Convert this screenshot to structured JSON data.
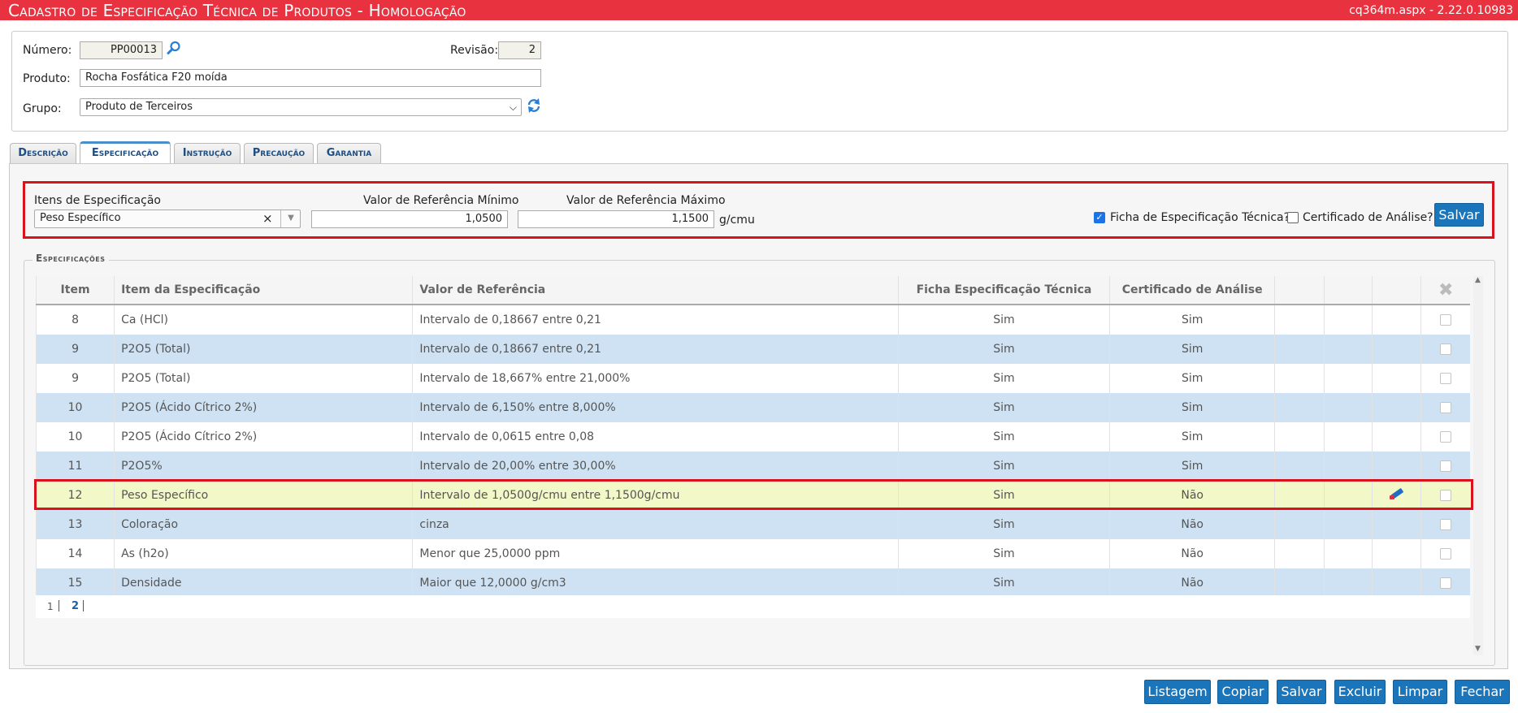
{
  "titlebar": {
    "title": "Cadastro de Especificação Técnica de Produtos  - Homologação",
    "version": "cq364m.aspx - 2.22.0.10983",
    "color": "#e8323f"
  },
  "header": {
    "numero_label": "Número:",
    "numero_value": "PP00013",
    "revisao_label": "Revisão:",
    "revisao_value": "2",
    "produto_label": "Produto:",
    "produto_value": "Rocha Fosfática F20 moída",
    "grupo_label": "Grupo:",
    "grupo_value": "Produto de Terceiros"
  },
  "tabs": [
    {
      "label": "Descrição",
      "active": false
    },
    {
      "label": "Especificação",
      "active": true
    },
    {
      "label": "Instrução",
      "active": false
    },
    {
      "label": "Precaução",
      "active": false
    },
    {
      "label": "Garantia",
      "active": false
    }
  ],
  "filter": {
    "itens_label": "Itens de Especificação",
    "itens_value": "Peso Específico",
    "clear_glyph": "×",
    "min_label": "Valor de Referência Mínimo",
    "min_value": "1,0500",
    "max_label": "Valor de Referência Máximo",
    "max_value": "1,1500",
    "unit": "g/cmu",
    "ficha_label": "Ficha de Especificação Técnica?",
    "ficha_checked": true,
    "cert_label": "Certificado de Análise?",
    "cert_checked": false,
    "save_label": "Salvar"
  },
  "specs": {
    "legend": "Especificações",
    "columns": [
      "Item",
      "Item da Especificação",
      "Valor de Referência",
      "Ficha Especificação Técnica",
      "Certificado de Análise"
    ],
    "rows": [
      {
        "item": "8",
        "name": "Ca (HCl)",
        "ref": "Intervalo de 0,18667 entre 0,21",
        "ficha": "Sim",
        "cert": "Sim"
      },
      {
        "item": "9",
        "name": "P2O5 (Total)",
        "ref": "Intervalo de 0,18667 entre 0,21",
        "ficha": "Sim",
        "cert": "Sim"
      },
      {
        "item": "9",
        "name": "P2O5 (Total)",
        "ref": "Intervalo de 18,667% entre 21,000%",
        "ficha": "Sim",
        "cert": "Sim"
      },
      {
        "item": "10",
        "name": "P2O5 (Ácido Cítrico 2%)",
        "ref": "Intervalo de 6,150% entre 8,000%",
        "ficha": "Sim",
        "cert": "Sim"
      },
      {
        "item": "10",
        "name": "P2O5 (Ácido Cítrico 2%)",
        "ref": "Intervalo de 0,0615 entre 0,08",
        "ficha": "Sim",
        "cert": "Sim"
      },
      {
        "item": "11",
        "name": "P2O5%",
        "ref": "Intervalo de 20,00% entre 30,00%",
        "ficha": "Sim",
        "cert": "Sim"
      },
      {
        "item": "12",
        "name": "Peso Específico",
        "ref": "Intervalo de 1,0500g/cmu entre 1,1500g/cmu",
        "ficha": "Sim",
        "cert": "Não"
      },
      {
        "item": "13",
        "name": "Coloração",
        "ref": "cinza",
        "ficha": "Sim",
        "cert": "Não"
      },
      {
        "item": "14",
        "name": "As (h2o)",
        "ref": "Menor que 25,0000 ppm",
        "ficha": "Sim",
        "cert": "Não"
      },
      {
        "item": "15",
        "name": "Densidade",
        "ref": "Maior que 12,0000 g/cm3",
        "ficha": "Sim",
        "cert": "Não"
      }
    ],
    "pager": [
      "1",
      "2"
    ]
  },
  "footer": {
    "listagem": "Listagem",
    "copiar": "Copiar",
    "salvar": "Salvar",
    "excluir": "Excluir",
    "limpar": "Limpar",
    "fechar": "Fechar"
  },
  "colors": {
    "accent": "#1a75bb",
    "row_alt": "#cfe2f3",
    "row_selected": "#f3f8c8",
    "highlight_border": "#d8131b"
  }
}
